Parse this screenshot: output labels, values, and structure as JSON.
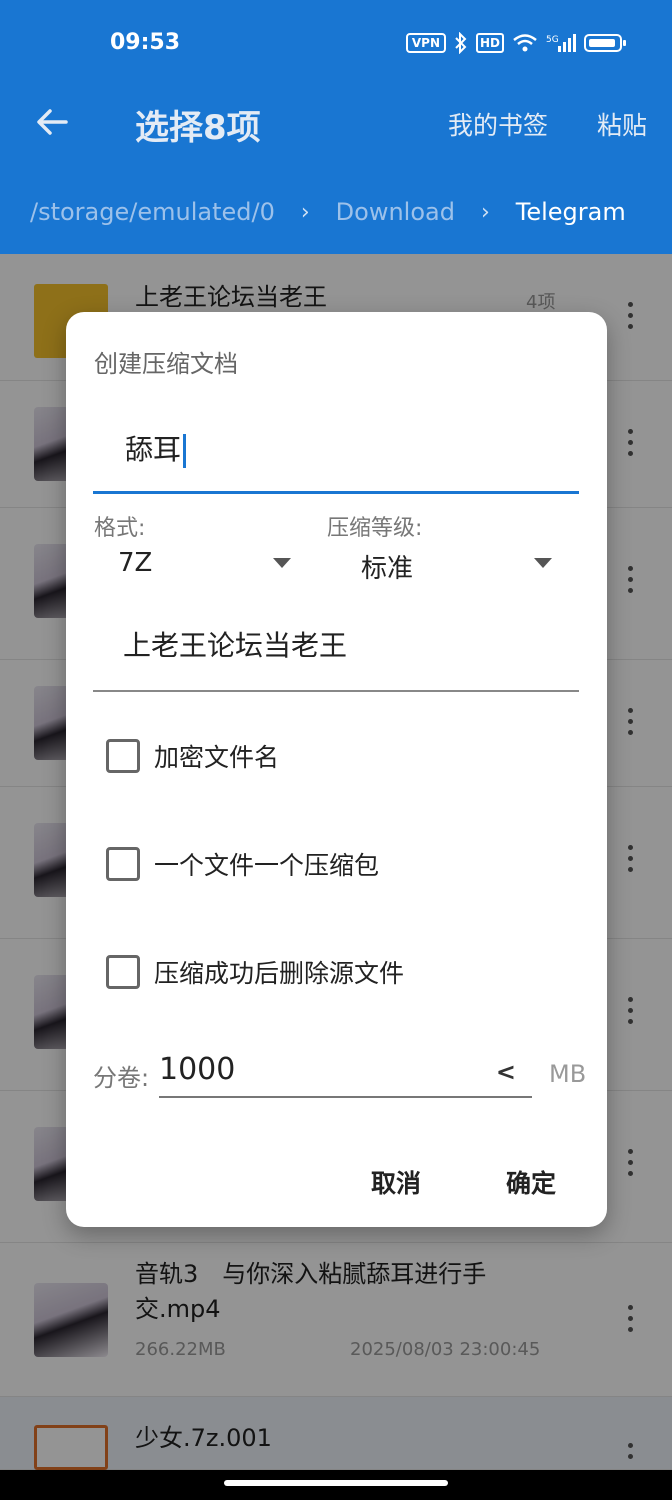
{
  "status": {
    "time": "09:53",
    "vpn": "VPN",
    "hd": "HD",
    "net": "5G"
  },
  "toolbar": {
    "title": "选择8项",
    "bookmarks": "我的书签",
    "paste": "粘贴"
  },
  "breadcrumb": {
    "root": "/storage/emulated/0",
    "mid": "Download",
    "current": "Telegram"
  },
  "list": {
    "folder": {
      "name": "上老王论坛当老王",
      "count": "4项"
    },
    "last_file": {
      "name": "音轨3　与你深入粘腻舔耳进行手交.mp4",
      "size": "266.22MB",
      "date": "2025/08/03 23:00:45"
    },
    "zip_file": {
      "name": "少女.7z.001"
    }
  },
  "dialog": {
    "title": "创建压缩文档",
    "archive_name": "舔耳",
    "format_label": "格式:",
    "format_value": "7Z",
    "level_label": "压缩等级:",
    "level_value": "标准",
    "output_path": "上老王论坛当老王",
    "options": [
      "加密文件名",
      "一个文件一个压缩包",
      "压缩成功后删除源文件"
    ],
    "split_label": "分卷:",
    "split_value": "1000",
    "split_unit": "MB",
    "cancel": "取消",
    "confirm": "确定"
  },
  "colors": {
    "accent": "#1976d2"
  }
}
